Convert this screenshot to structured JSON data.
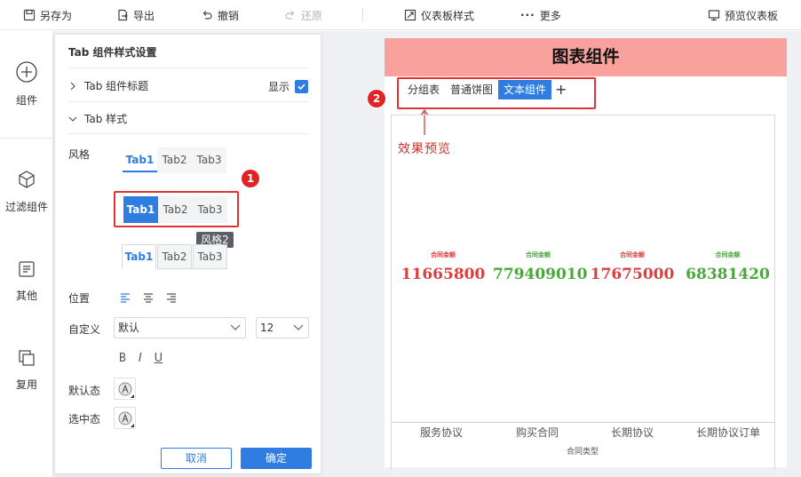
{
  "toolbar": {
    "save_as": "另存为",
    "export": "导出",
    "undo": "撤销",
    "redo": "还原",
    "dashboard_style": "仪表板样式",
    "more": "更多",
    "preview": "预览仪表板"
  },
  "sidebar": {
    "items": [
      {
        "label": "组件",
        "icon": "plus-circle-icon"
      },
      {
        "label": "过滤组件",
        "icon": "cube-icon"
      },
      {
        "label": "其他",
        "icon": "document-icon"
      },
      {
        "label": "复用",
        "icon": "copy-icon"
      }
    ]
  },
  "panel": {
    "title": "Tab 组件样式设置",
    "section_title": "Tab 组件标题",
    "show_label": "显示",
    "show_checked": true,
    "section_style": "Tab 样式",
    "style_label": "风格",
    "tabs": [
      "Tab1",
      "Tab2",
      "Tab3"
    ],
    "tooltip": "风格2",
    "position_label": "位置",
    "custom_label": "自定义",
    "font_select": "默认",
    "size_select": "12",
    "bold": "B",
    "italic": "I",
    "underline": "U",
    "default_state": "默认态",
    "selected_state": "选中态",
    "cancel": "取消",
    "ok": "确定",
    "badge1": "1"
  },
  "preview": {
    "title": "图表组件",
    "tabs": [
      "分组表",
      "普通饼图",
      "文本组件"
    ],
    "active_tab": "文本组件",
    "plus": "+",
    "badge2": "2",
    "note": "效果预览",
    "kpi_label": "合同金额",
    "x_title": "合同类型"
  },
  "chart_data": {
    "type": "table",
    "categories": [
      "服务协议",
      "购买合同",
      "长期协议",
      "长期协议订单"
    ],
    "series": [
      {
        "name": "合同金额",
        "values": [
          11665800,
          779409010,
          17675000,
          68381420
        ]
      }
    ],
    "xlabel": "合同类型",
    "colors": [
      "#d94040",
      "#48a93a",
      "#d94040",
      "#48a93a"
    ]
  }
}
